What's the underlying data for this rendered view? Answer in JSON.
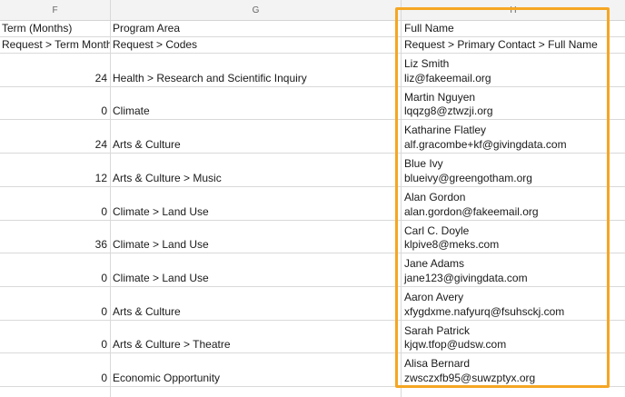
{
  "columns": {
    "f": "F",
    "g": "G",
    "h": "H"
  },
  "header_row": {
    "f": "Term (Months)",
    "g": "Program Area",
    "h": "Full Name"
  },
  "path_row": {
    "f": "Request > Term Month",
    "g": "Request > Codes",
    "h": "Request > Primary Contact > Full Name"
  },
  "rows": [
    {
      "term": "24",
      "program": "Health > Research and Scientific Inquiry",
      "name": "Liz Smith",
      "email": "liz@fakeemail.org"
    },
    {
      "term": "0",
      "program": "Climate",
      "name": "Martin Nguyen",
      "email": "lqqzg8@ztwzji.org"
    },
    {
      "term": "24",
      "program": "Arts & Culture",
      "name": "Katharine Flatley",
      "email": "alf.gracombe+kf@givingdata.com"
    },
    {
      "term": "12",
      "program": "Arts & Culture > Music",
      "name": "Blue Ivy",
      "email": "blueivy@greengotham.org"
    },
    {
      "term": "0",
      "program": "Climate > Land Use",
      "name": "Alan Gordon",
      "email": "alan.gordon@fakeemail.org"
    },
    {
      "term": "36",
      "program": "Climate > Land Use",
      "name": "Carl C. Doyle",
      "email": "klpive8@meks.com"
    },
    {
      "term": "0",
      "program": "Climate > Land Use",
      "name": "Jane Adams",
      "email": "jane123@givingdata.com"
    },
    {
      "term": "0",
      "program": "Arts & Culture",
      "name": "Aaron Avery",
      "email": "xfygdxme.nafyurq@fsuhsckj.com"
    },
    {
      "term": "0",
      "program": "Arts & Culture > Theatre",
      "name": "Sarah Patrick",
      "email": "kjqw.tfop@udsw.com"
    },
    {
      "term": "0",
      "program": "Economic Opportunity",
      "name": "Alisa Bernard",
      "email": "zwsczxfb95@suwzptyx.org"
    }
  ],
  "colors": {
    "highlight": "#f5a623",
    "grid": "#d9d9d9",
    "header_bg": "#f3f3f3"
  }
}
